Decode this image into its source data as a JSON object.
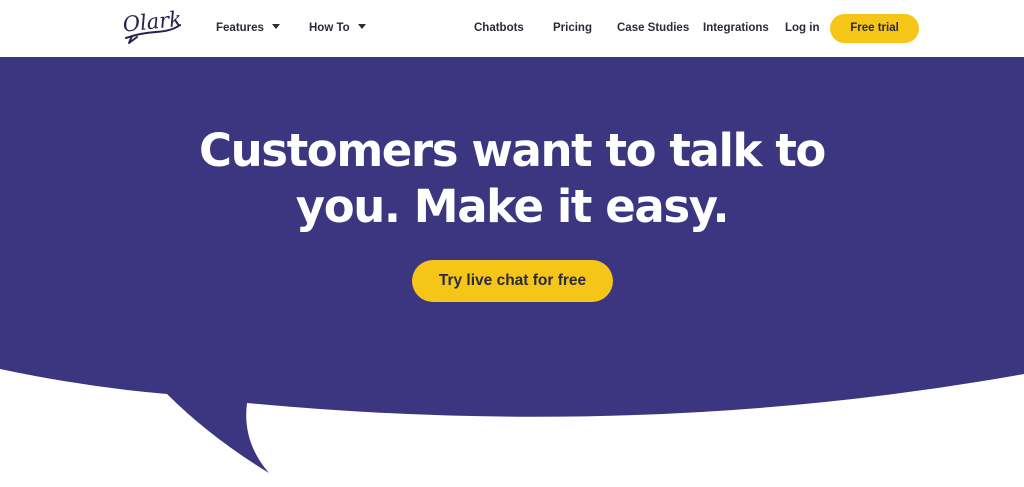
{
  "brand": {
    "logo_text": "Olark"
  },
  "nav": {
    "features": "Features",
    "howto": "How To",
    "chatbots": "Chatbots",
    "pricing": "Pricing",
    "case_studies": "Case Studies",
    "integrations": "Integrations",
    "login": "Log in",
    "free_trial": "Free trial"
  },
  "hero": {
    "headline_line1": "Customers want to talk to",
    "headline_line2": "you. Make it easy.",
    "cta": "Try live chat for free"
  },
  "colors": {
    "hero_purple": "#3c3580",
    "accent_yellow": "#f5c518",
    "nav_text": "#2b2b3a"
  },
  "icons": [
    "chevron-down-icon",
    "olark-logo"
  ]
}
